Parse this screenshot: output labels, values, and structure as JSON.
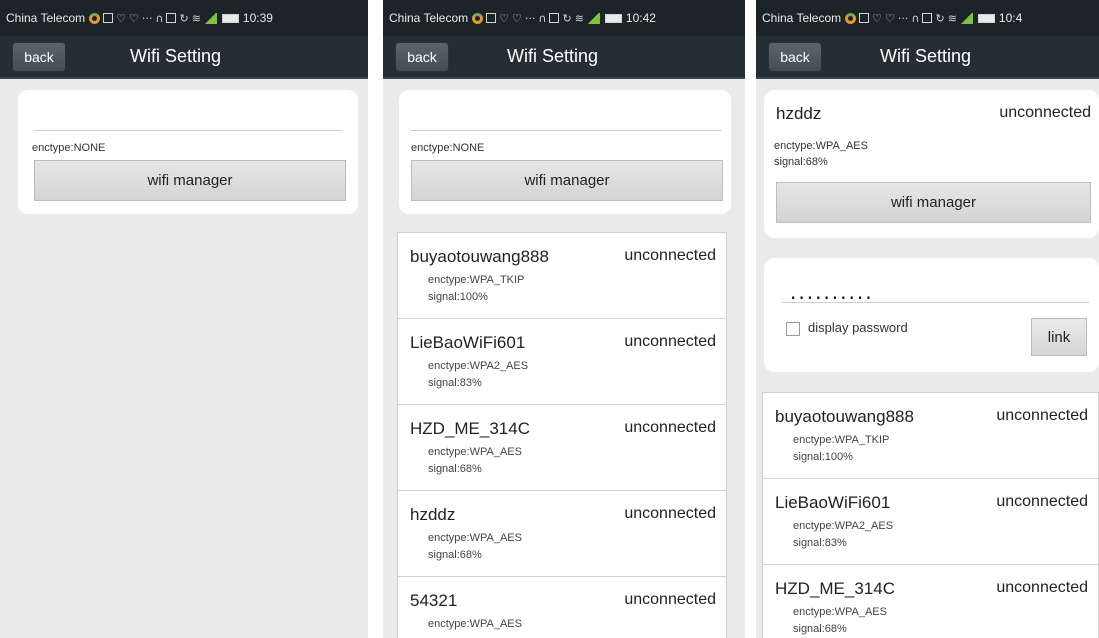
{
  "screens": [
    {
      "status": {
        "carrier": "China Telecom",
        "time": "10:39"
      },
      "header": {
        "back_label": "back",
        "title": "Wifi Setting"
      },
      "current": {
        "ssid": "",
        "enctype": "enctype:NONE",
        "button_label": "wifi manager"
      }
    },
    {
      "status": {
        "carrier": "China Telecom",
        "time": "10:42"
      },
      "header": {
        "back_label": "back",
        "title": "Wifi Setting"
      },
      "current": {
        "ssid": "",
        "enctype": "enctype:NONE",
        "button_label": "wifi manager"
      },
      "networks": [
        {
          "ssid": "buyaotouwang888",
          "state": "unconnected",
          "enctype": "enctype:WPA_TKIP",
          "signal": "signal:100%"
        },
        {
          "ssid": "LieBaoWiFi601",
          "state": "unconnected",
          "enctype": "enctype:WPA2_AES",
          "signal": "signal:83%"
        },
        {
          "ssid": "HZD_ME_314C",
          "state": "unconnected",
          "enctype": "enctype:WPA_AES",
          "signal": "signal:68%"
        },
        {
          "ssid": "hzddz",
          "state": "unconnected",
          "enctype": "enctype:WPA_AES",
          "signal": "signal:68%"
        },
        {
          "ssid": "54321",
          "state": "unconnected",
          "enctype": "enctype:WPA_AES",
          "signal": ""
        }
      ]
    },
    {
      "status": {
        "carrier": "China Telecom",
        "time": "10:4"
      },
      "header": {
        "back_label": "back",
        "title": "Wifi Setting"
      },
      "current": {
        "ssid": "hzddz",
        "state": "unconnected",
        "enctype": "enctype:WPA_AES",
        "signal": "signal:68%",
        "button_label": "wifi manager"
      },
      "password": {
        "value": "..........",
        "display_label": "display password",
        "link_label": "link"
      },
      "networks": [
        {
          "ssid": "buyaotouwang888",
          "state": "unconnected",
          "enctype": "enctype:WPA_TKIP",
          "signal": "signal:100%"
        },
        {
          "ssid": "LieBaoWiFi601",
          "state": "unconnected",
          "enctype": "enctype:WPA2_AES",
          "signal": "signal:83%"
        },
        {
          "ssid": "HZD_ME_314C",
          "state": "unconnected",
          "enctype": "enctype:WPA_AES",
          "signal": "signal:68%"
        }
      ]
    }
  ],
  "icons": [
    "signal-ring-icon",
    "status-icons",
    "battery-icon"
  ]
}
